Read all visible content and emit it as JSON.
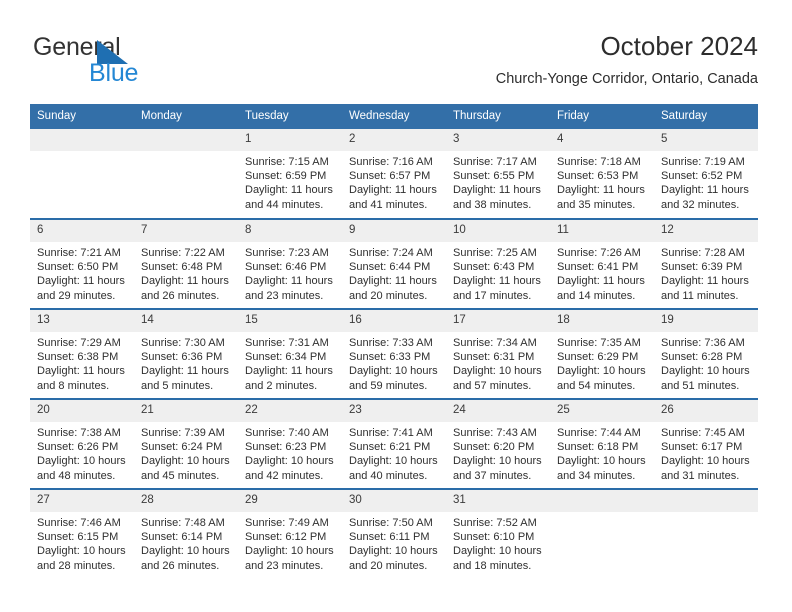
{
  "logo": {
    "word_top": "General",
    "word_bottom": "Blue",
    "triangle_color": "#1f6fb2",
    "blue_text_color": "#2487d4",
    "icon": "general-blue-logo"
  },
  "header": {
    "title": "October 2024",
    "subtitle": "Church-Yonge Corridor, Ontario, Canada"
  },
  "theme": {
    "header_blue": "#336fa8",
    "row_divider_blue": "#2a6ca8",
    "daynum_band": "#efefef"
  },
  "calendar": {
    "weekdays": [
      "Sunday",
      "Monday",
      "Tuesday",
      "Wednesday",
      "Thursday",
      "Friday",
      "Saturday"
    ],
    "weeks": [
      [
        {
          "day": "",
          "lines": []
        },
        {
          "day": "",
          "lines": []
        },
        {
          "day": "1",
          "lines": [
            "Sunrise: 7:15 AM",
            "Sunset: 6:59 PM",
            "Daylight: 11 hours",
            "and 44 minutes."
          ]
        },
        {
          "day": "2",
          "lines": [
            "Sunrise: 7:16 AM",
            "Sunset: 6:57 PM",
            "Daylight: 11 hours",
            "and 41 minutes."
          ]
        },
        {
          "day": "3",
          "lines": [
            "Sunrise: 7:17 AM",
            "Sunset: 6:55 PM",
            "Daylight: 11 hours",
            "and 38 minutes."
          ]
        },
        {
          "day": "4",
          "lines": [
            "Sunrise: 7:18 AM",
            "Sunset: 6:53 PM",
            "Daylight: 11 hours",
            "and 35 minutes."
          ]
        },
        {
          "day": "5",
          "lines": [
            "Sunrise: 7:19 AM",
            "Sunset: 6:52 PM",
            "Daylight: 11 hours",
            "and 32 minutes."
          ]
        }
      ],
      [
        {
          "day": "6",
          "lines": [
            "Sunrise: 7:21 AM",
            "Sunset: 6:50 PM",
            "Daylight: 11 hours",
            "and 29 minutes."
          ]
        },
        {
          "day": "7",
          "lines": [
            "Sunrise: 7:22 AM",
            "Sunset: 6:48 PM",
            "Daylight: 11 hours",
            "and 26 minutes."
          ]
        },
        {
          "day": "8",
          "lines": [
            "Sunrise: 7:23 AM",
            "Sunset: 6:46 PM",
            "Daylight: 11 hours",
            "and 23 minutes."
          ]
        },
        {
          "day": "9",
          "lines": [
            "Sunrise: 7:24 AM",
            "Sunset: 6:44 PM",
            "Daylight: 11 hours",
            "and 20 minutes."
          ]
        },
        {
          "day": "10",
          "lines": [
            "Sunrise: 7:25 AM",
            "Sunset: 6:43 PM",
            "Daylight: 11 hours",
            "and 17 minutes."
          ]
        },
        {
          "day": "11",
          "lines": [
            "Sunrise: 7:26 AM",
            "Sunset: 6:41 PM",
            "Daylight: 11 hours",
            "and 14 minutes."
          ]
        },
        {
          "day": "12",
          "lines": [
            "Sunrise: 7:28 AM",
            "Sunset: 6:39 PM",
            "Daylight: 11 hours",
            "and 11 minutes."
          ]
        }
      ],
      [
        {
          "day": "13",
          "lines": [
            "Sunrise: 7:29 AM",
            "Sunset: 6:38 PM",
            "Daylight: 11 hours",
            "and 8 minutes."
          ]
        },
        {
          "day": "14",
          "lines": [
            "Sunrise: 7:30 AM",
            "Sunset: 6:36 PM",
            "Daylight: 11 hours",
            "and 5 minutes."
          ]
        },
        {
          "day": "15",
          "lines": [
            "Sunrise: 7:31 AM",
            "Sunset: 6:34 PM",
            "Daylight: 11 hours",
            "and 2 minutes."
          ]
        },
        {
          "day": "16",
          "lines": [
            "Sunrise: 7:33 AM",
            "Sunset: 6:33 PM",
            "Daylight: 10 hours",
            "and 59 minutes."
          ]
        },
        {
          "day": "17",
          "lines": [
            "Sunrise: 7:34 AM",
            "Sunset: 6:31 PM",
            "Daylight: 10 hours",
            "and 57 minutes."
          ]
        },
        {
          "day": "18",
          "lines": [
            "Sunrise: 7:35 AM",
            "Sunset: 6:29 PM",
            "Daylight: 10 hours",
            "and 54 minutes."
          ]
        },
        {
          "day": "19",
          "lines": [
            "Sunrise: 7:36 AM",
            "Sunset: 6:28 PM",
            "Daylight: 10 hours",
            "and 51 minutes."
          ]
        }
      ],
      [
        {
          "day": "20",
          "lines": [
            "Sunrise: 7:38 AM",
            "Sunset: 6:26 PM",
            "Daylight: 10 hours",
            "and 48 minutes."
          ]
        },
        {
          "day": "21",
          "lines": [
            "Sunrise: 7:39 AM",
            "Sunset: 6:24 PM",
            "Daylight: 10 hours",
            "and 45 minutes."
          ]
        },
        {
          "day": "22",
          "lines": [
            "Sunrise: 7:40 AM",
            "Sunset: 6:23 PM",
            "Daylight: 10 hours",
            "and 42 minutes."
          ]
        },
        {
          "day": "23",
          "lines": [
            "Sunrise: 7:41 AM",
            "Sunset: 6:21 PM",
            "Daylight: 10 hours",
            "and 40 minutes."
          ]
        },
        {
          "day": "24",
          "lines": [
            "Sunrise: 7:43 AM",
            "Sunset: 6:20 PM",
            "Daylight: 10 hours",
            "and 37 minutes."
          ]
        },
        {
          "day": "25",
          "lines": [
            "Sunrise: 7:44 AM",
            "Sunset: 6:18 PM",
            "Daylight: 10 hours",
            "and 34 minutes."
          ]
        },
        {
          "day": "26",
          "lines": [
            "Sunrise: 7:45 AM",
            "Sunset: 6:17 PM",
            "Daylight: 10 hours",
            "and 31 minutes."
          ]
        }
      ],
      [
        {
          "day": "27",
          "lines": [
            "Sunrise: 7:46 AM",
            "Sunset: 6:15 PM",
            "Daylight: 10 hours",
            "and 28 minutes."
          ]
        },
        {
          "day": "28",
          "lines": [
            "Sunrise: 7:48 AM",
            "Sunset: 6:14 PM",
            "Daylight: 10 hours",
            "and 26 minutes."
          ]
        },
        {
          "day": "29",
          "lines": [
            "Sunrise: 7:49 AM",
            "Sunset: 6:12 PM",
            "Daylight: 10 hours",
            "and 23 minutes."
          ]
        },
        {
          "day": "30",
          "lines": [
            "Sunrise: 7:50 AM",
            "Sunset: 6:11 PM",
            "Daylight: 10 hours",
            "and 20 minutes."
          ]
        },
        {
          "day": "31",
          "lines": [
            "Sunrise: 7:52 AM",
            "Sunset: 6:10 PM",
            "Daylight: 10 hours",
            "and 18 minutes."
          ]
        },
        {
          "day": "",
          "lines": []
        },
        {
          "day": "",
          "lines": []
        }
      ]
    ]
  }
}
